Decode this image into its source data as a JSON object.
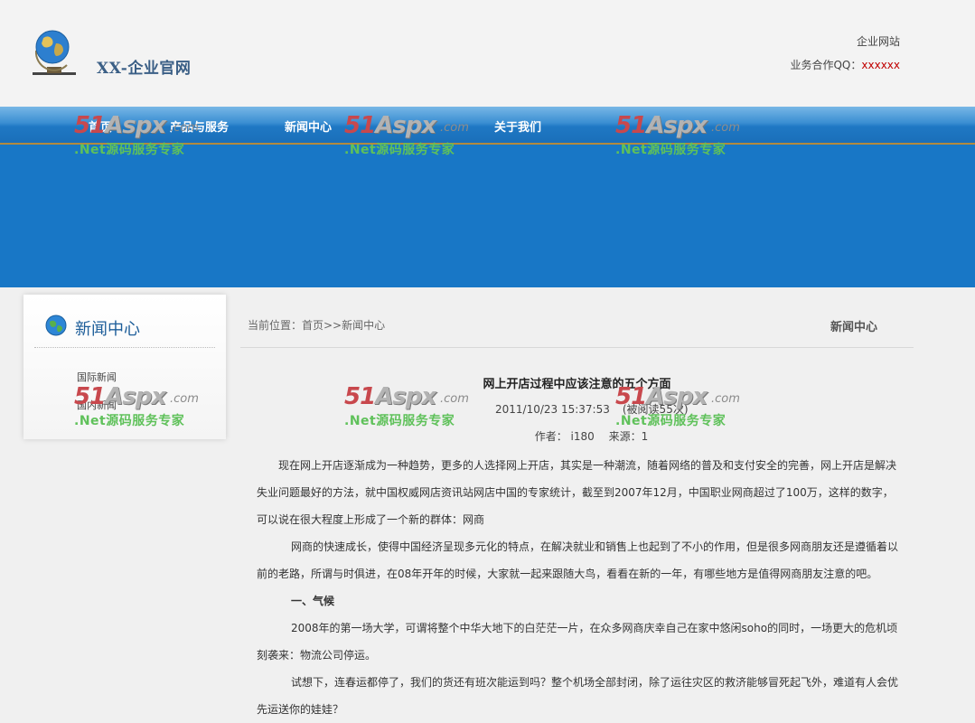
{
  "header": {
    "site_title": "XX-企业官网",
    "right_line1": "企业网站",
    "qq_label": "业务合作QQ：",
    "qq_value": "xxxxxx"
  },
  "nav": {
    "items": [
      "首页",
      "产品与服务",
      "新闻中心",
      "关于我们"
    ]
  },
  "sidebar": {
    "title": "新闻中心",
    "links": [
      "国际新闻",
      "国内新闻"
    ]
  },
  "breadcrumb": {
    "text": "当前位置：首页>>新闻中心",
    "right_title": "新闻中心"
  },
  "article": {
    "title": "网上开店过程中应该注意的五个方面",
    "date": "2011/10/23 15:37:53",
    "views": "(被阅读55次)",
    "author": "作者： i180　 来源：1",
    "paragraphs": [
      "现在网上开店逐渐成为一种趋势，更多的人选择网上开店，其实是一种潮流，随着网络的普及和支付安全的完善，网上开店是解决失业问题最好的方法，就中国权威网店资讯站网店中国的专家统计，截至到2007年12月，中国职业网商超过了100万，这样的数字，可以说在很大程度上形成了一个新的群体：网商",
      "网商的快速成长，使得中国经济呈现多元化的特点，在解决就业和销售上也起到了不小的作用，但是很多网商朋友还是遵循着以前的老路，所谓与时俱进，在08年开年的时候，大家就一起来跟随大鸟，看看在新的一年，有哪些地方是值得网商朋友注意的吧。",
      "一、气候",
      "2008年的第一场大学，可谓将整个中华大地下的白茫茫一片，在众多网商庆幸自己在家中悠闲soho的同时，一场更大的危机顷刻袭来：物流公司停运。",
      "试想下，连春运都停了，我们的货还有班次能运到吗？整个机场全部封闭，除了运往灾区的救济能够冒死起飞外，难道有人会优先运送你的娃娃？"
    ]
  },
  "watermark": {
    "brand_a": "51",
    "brand_b": "Aspx",
    "brand_c": ".com",
    "tagline": ".Net源码服务专家"
  },
  "colors": {
    "nav_blue": "#1a6fb9",
    "banner_blue": "#1877c6",
    "qq_red": "#c00000",
    "title_blue": "#3b5f86"
  }
}
